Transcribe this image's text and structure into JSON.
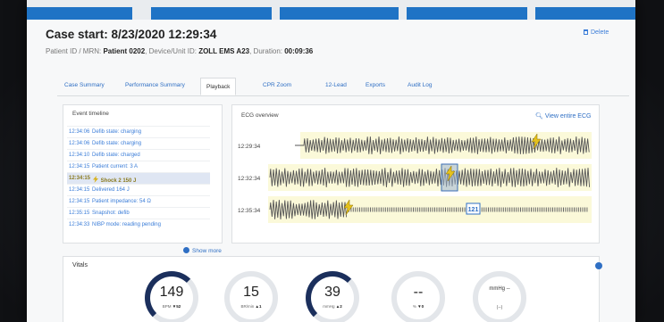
{
  "header": {
    "case_start": "Case start: 8/23/2020 12:29:34",
    "patient_label": "Patient ID / MRN: ",
    "patient_value": "Patient 0202",
    "device_label": ", Device/Unit ID: ",
    "device_value": "ZOLL EMS A23",
    "duration_label": ", Duration: ",
    "duration_value": "00:09:36",
    "delete_label": "Delete"
  },
  "tabs": [
    "Case Summary",
    "Performance Summary",
    "Playback",
    "CPR Zoom",
    "12-Lead",
    "Exports",
    "Audit Log"
  ],
  "active_tab": "Playback",
  "event_timeline": {
    "title": "Event timeline",
    "events": [
      {
        "time": "12:34:06",
        "desc": "Defib state: charging"
      },
      {
        "time": "12:34:06",
        "desc": "Defib state: charging"
      },
      {
        "time": "12:34:10",
        "desc": "Defib state: charged"
      },
      {
        "time": "12:34:15",
        "desc": "Patient current: 3 A"
      },
      {
        "time": "12:34:15",
        "desc": "Shock 2 150 J",
        "highlighted": true
      },
      {
        "time": "12:34:15",
        "desc": "Delivered 164 J"
      },
      {
        "time": "12:34:15",
        "desc": "Patient impedance: 54 Ω"
      },
      {
        "time": "12:35:15",
        "desc": "Snapshot: defib"
      },
      {
        "time": "12:34:33",
        "desc": "NIBP mode: reading pending"
      }
    ],
    "show_more": "Show more"
  },
  "ecg_overview": {
    "title": "ECG overview",
    "view_link": "View entire ECG",
    "strip_times": [
      "12:29:34",
      "12:32:34",
      "12:35:34"
    ],
    "overlay_badge": "121"
  },
  "vitals": {
    "title": "Vitals",
    "gauges": [
      {
        "value": "149",
        "unit": "BPM",
        "trend": "▼52"
      },
      {
        "value": "15",
        "unit": "BR/min",
        "trend": "▲1"
      },
      {
        "value": "39",
        "unit": "mmHg",
        "trend": "▲2"
      },
      {
        "value": "--",
        "unit": "%",
        "trend": "▼0"
      },
      {
        "value": "--",
        "unit": "mmHg",
        "trend": "(--)"
      }
    ]
  },
  "colors": {
    "accent": "#2f6fc4",
    "nav_blue": "#1f73c5",
    "strip_bg": "#fbf9d9",
    "highlight_row": "#dfe6f3",
    "gauge_dark": "#1b2f5c"
  }
}
